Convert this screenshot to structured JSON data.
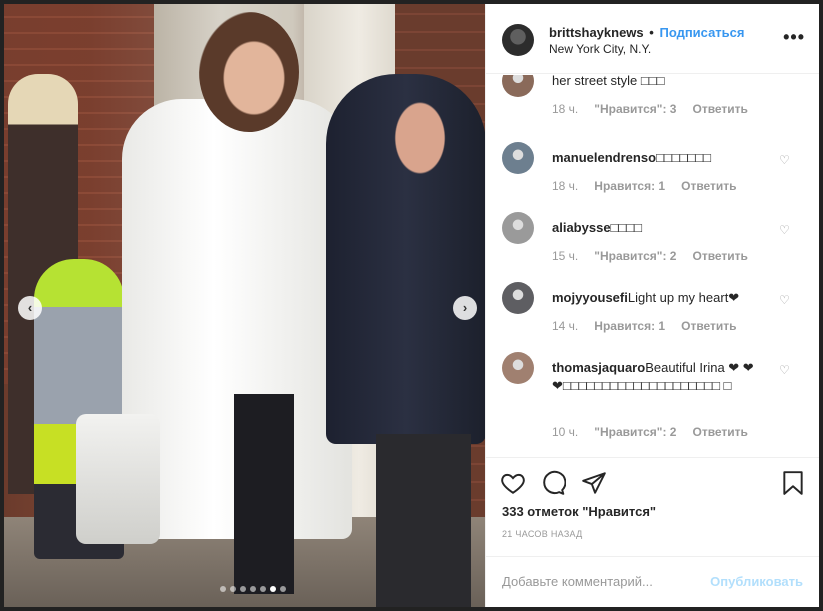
{
  "photo": {
    "alt": "",
    "carousel_dots": 7,
    "active_dot": 5
  },
  "header": {
    "username": "brittshayknews",
    "separator": "•",
    "follow_label": "Подписаться",
    "location": "New York City, N.Y.",
    "more_icon": "more-icon"
  },
  "comments": [
    {
      "text": "her street style □□□",
      "user": "",
      "time": "18 ч.",
      "likes": "\"Нравится\": 3",
      "reply": "Ответить",
      "avatar_color": "#8a6a5a",
      "partial": true
    },
    {
      "user": "manuelendrenso",
      "text": "□□□□□□□",
      "time": "18 ч.",
      "likes": "Нравится: 1",
      "reply": "Ответить",
      "avatar_color": "#6d7f8f"
    },
    {
      "user": "aliabysse",
      "text": "□□□□",
      "time": "15 ч.",
      "likes": "\"Нравится\": 2",
      "reply": "Ответить",
      "avatar_color": "#9a9a9a"
    },
    {
      "user": "mojyyousefi",
      "text": "Light up my heart❤",
      "time": "14 ч.",
      "likes": "Нравится: 1",
      "reply": "Ответить",
      "avatar_color": "#5e5e62"
    },
    {
      "user": "thomasjaquaro",
      "text": "Beautiful Irina ❤ ❤❤□□□□□□□□□□□□□□□□□□□□ □",
      "time": "10 ч.",
      "likes": "\"Нравится\": 2",
      "reply": "Ответить",
      "avatar_color": "#a08070"
    }
  ],
  "actions": {
    "like_icon": "heart-icon",
    "comment_icon": "comment-icon",
    "share_icon": "share-icon",
    "save_icon": "bookmark-icon",
    "likes_text": "333 отметок \"Нравится\"",
    "time_ago": "21 ЧАСОВ НАЗАД"
  },
  "add_comment": {
    "placeholder": "Добавьте комментарий...",
    "post_label": "Опубликовать"
  },
  "colors": {
    "accent": "#3897f0",
    "post_disabled": "#b2dffc",
    "muted": "#999999",
    "text": "#262626"
  }
}
